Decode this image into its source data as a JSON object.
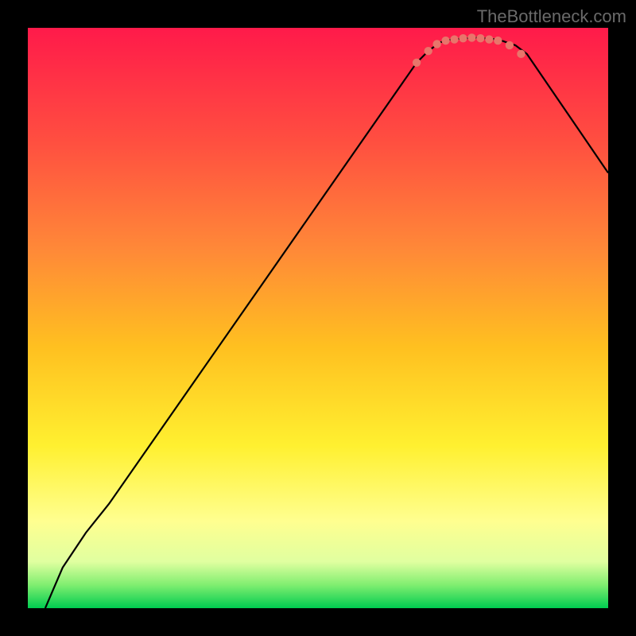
{
  "watermark": "TheBottleneck.com",
  "chart_data": {
    "type": "line",
    "title": "",
    "xlabel": "",
    "ylabel": "",
    "xlim": [
      0,
      100
    ],
    "ylim": [
      0,
      100
    ],
    "gradient_colors": {
      "top": "#ff1a4a",
      "upper_mid": "#ff6040",
      "mid": "#ffd000",
      "lower_mid": "#ffff60",
      "near_bottom": "#d0ff60",
      "bottom": "#00dd55"
    },
    "curve_points": [
      {
        "x": 3,
        "y": 0
      },
      {
        "x": 6,
        "y": 7
      },
      {
        "x": 10,
        "y": 13
      },
      {
        "x": 14,
        "y": 18
      },
      {
        "x": 67,
        "y": 94
      },
      {
        "x": 69,
        "y": 96
      },
      {
        "x": 71,
        "y": 97.5
      },
      {
        "x": 73,
        "y": 98
      },
      {
        "x": 77,
        "y": 98.3
      },
      {
        "x": 81,
        "y": 98
      },
      {
        "x": 84,
        "y": 97
      },
      {
        "x": 86,
        "y": 95.5
      },
      {
        "x": 100,
        "y": 75
      }
    ],
    "markers": [
      {
        "x": 67,
        "y": 94
      },
      {
        "x": 69,
        "y": 96
      },
      {
        "x": 70.5,
        "y": 97.2
      },
      {
        "x": 72,
        "y": 97.8
      },
      {
        "x": 73.5,
        "y": 98
      },
      {
        "x": 75,
        "y": 98.2
      },
      {
        "x": 76.5,
        "y": 98.3
      },
      {
        "x": 78,
        "y": 98.2
      },
      {
        "x": 79.5,
        "y": 98
      },
      {
        "x": 81,
        "y": 97.8
      },
      {
        "x": 83,
        "y": 97
      },
      {
        "x": 85,
        "y": 95.5
      }
    ],
    "marker_color": "#e8756b",
    "curve_color": "#000000"
  }
}
